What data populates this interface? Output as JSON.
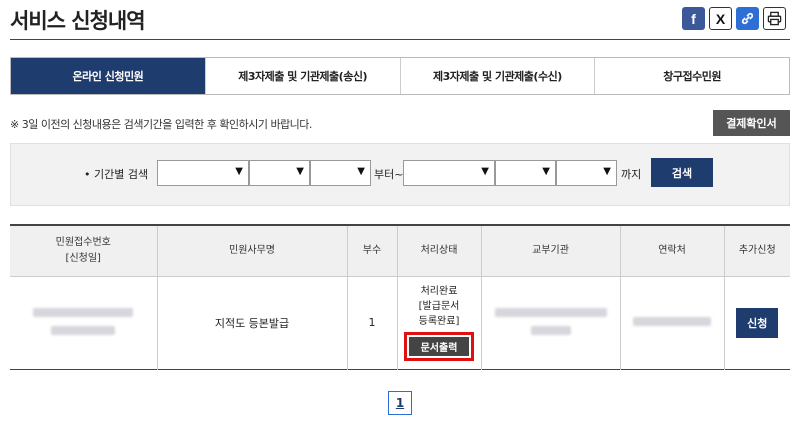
{
  "header": {
    "title": "서비스 신청내역",
    "share_icons": [
      "facebook-icon",
      "x-icon",
      "link-icon",
      "print-icon"
    ]
  },
  "tabs": [
    {
      "label": "온라인 신청민원",
      "active": true
    },
    {
      "label": "제3자제출 및 기관제출(송신)",
      "active": false
    },
    {
      "label": "제3자제출 및 기관제출(수신)",
      "active": false
    },
    {
      "label": "창구접수민원",
      "active": false
    }
  ],
  "notice": "※ 3일 이전의 신청내용은 검색기간을 입력한 후 확인하시기 바랍니다.",
  "pay_button": "결제확인서",
  "search": {
    "label": "• 기간별 검색",
    "from_sep": "부터~",
    "to_sep": "까지",
    "button": "검색"
  },
  "table": {
    "headers": [
      "민원접수번호\n[신청일]",
      "민원사무명",
      "부수",
      "처리상태",
      "교부기관",
      "연락처",
      "추가신청"
    ],
    "rows": [
      {
        "service_name": "지적도 등본발급",
        "count": "1",
        "status_lines": [
          "처리완료",
          "[발급문서",
          "등록완료]"
        ],
        "doc_button": "문서출력",
        "apply_button": "신청"
      }
    ]
  },
  "pagination": {
    "current": "1"
  },
  "colors": {
    "primary": "#1f3c6e",
    "highlight": "#e01010",
    "gray_button": "#555555"
  }
}
